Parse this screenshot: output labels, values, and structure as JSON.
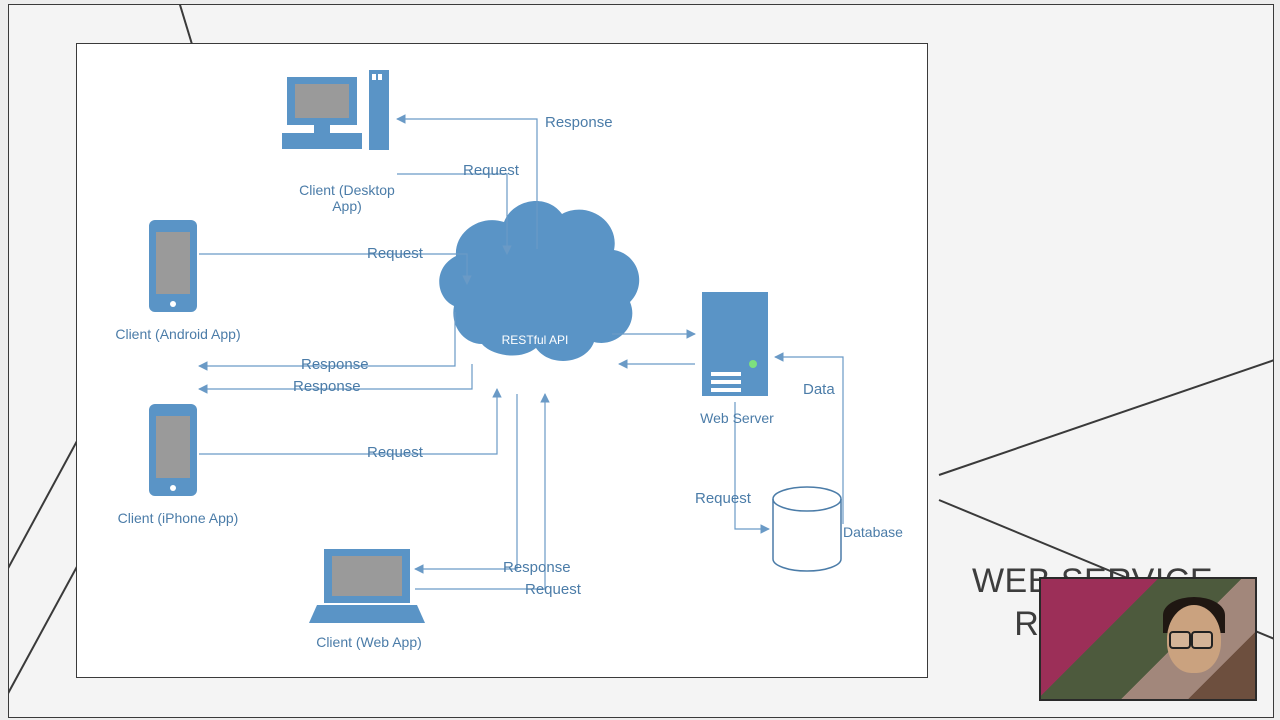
{
  "title": {
    "line1": "WEB SERVICE",
    "line2": "REST API"
  },
  "diagram": {
    "center": "RESTful API",
    "nodes": {
      "desktop": "Client (Desktop App)",
      "android": "Client (Android App)",
      "iphone": "Client (iPhone App)",
      "web": "Client (Web App)",
      "server": "Web Server",
      "db": "Database"
    },
    "labels": {
      "request": "Request",
      "response": "Response",
      "data": "Data"
    }
  }
}
